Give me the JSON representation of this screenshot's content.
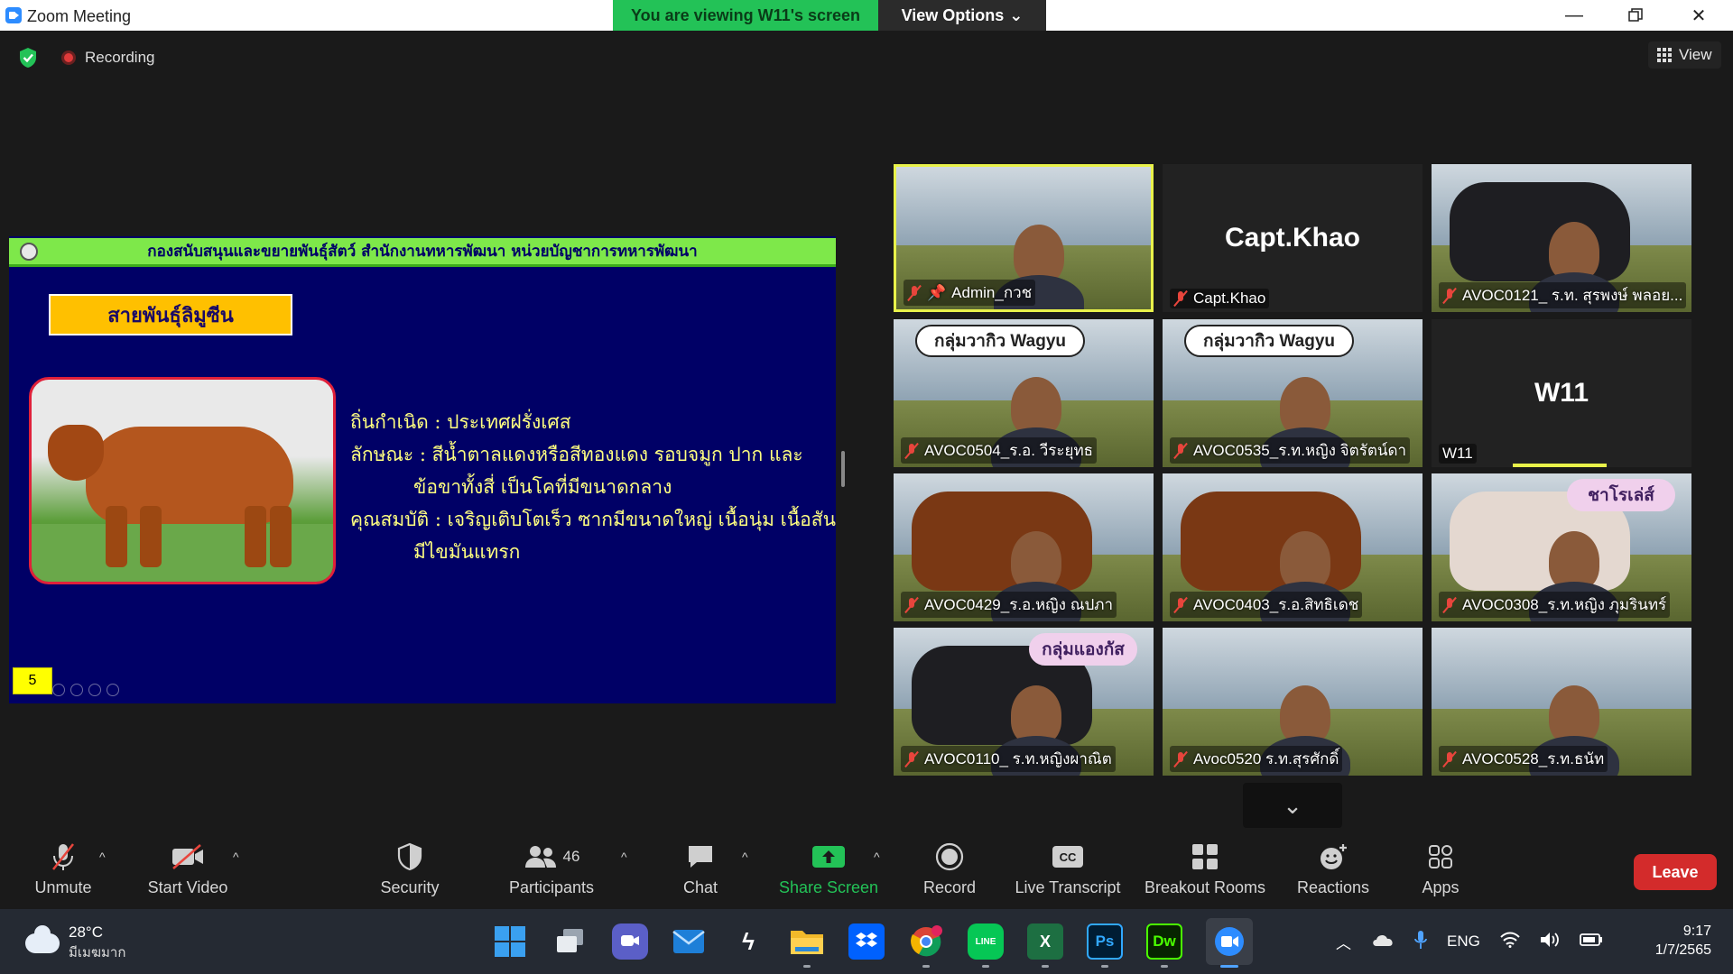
{
  "window": {
    "title": "Zoom Meeting",
    "banner": "You are viewing W11's screen",
    "view_options": "View Options"
  },
  "meeting_bar": {
    "recording": "Recording",
    "view": "View"
  },
  "slide": {
    "header": "กองสนับสนุนและขยายพันธุ์สัตว์ สำนักงานทหารพัฒนา หน่วยบัญชาการทหารพัฒนา",
    "breed_title": "สายพันธุ์ลิมูซีน",
    "lines": [
      "ถิ่นกำเนิด : ประเทศฝรั่งเศส",
      "ลักษณะ  : สีน้ำตาลแดงหรือสีทองแดง รอบจมูก ปาก และ",
      "ข้อขาทั้งสี่ เป็นโคที่มีขนาดกลาง",
      "คุณสมบัติ : เจริญเติบโตเร็ว ซากมีขนาดใหญ่ เนื้อนุ่ม เนื้อสัน",
      "มีไขมันแทรก"
    ],
    "page_number": "5"
  },
  "gallery": [
    {
      "name": "Admin_กวช",
      "bg": "#d8d4c8",
      "pinned": true,
      "active": true
    },
    {
      "name": "Capt.Khao",
      "big": "Capt.Khao",
      "bg": "#222222"
    },
    {
      "name": "AVOC0121_ ร.ท. สุรพงษ์  พลอย...",
      "bg": "#3b4050"
    },
    {
      "name": "AVOC0504_ร.อ. วีระยุทธ",
      "bubble": "กลุ่มวากิว Wagyu",
      "bg": "#8a9a7a"
    },
    {
      "name": "AVOC0535_ร.ท.หญิง จิตรัตน์ดา",
      "bubble": "กลุ่มวากิว Wagyu",
      "bg": "#8a9a7a"
    },
    {
      "name": "W11",
      "big": "W11",
      "bg": "#222222"
    },
    {
      "name": "AVOC0429_ร.อ.หญิง ณปภา",
      "bg": "#7a7a5a"
    },
    {
      "name": "AVOC0403_ร.อ.สิทธิเดช",
      "bg": "#7a7a5a"
    },
    {
      "name": "AVOC0308_ร.ท.หญิง ภุมรินทร์",
      "label": "ชาโรเล่ส์",
      "bg": "#c4a8c8"
    },
    {
      "name": "AVOC0110_ ร.ท.หญิงผาณิต",
      "label": "กลุ่มแองกัส",
      "bg": "#7ab04a"
    },
    {
      "name": "Avoc0520 ร.ท.สุรศักดิ์",
      "bg": "#d8d8d8"
    },
    {
      "name": "AVOC0528_ร.ท.ธนัท",
      "bg": "#6a5a40"
    }
  ],
  "toolbar": {
    "unmute": "Unmute",
    "start_video": "Start Video",
    "security": "Security",
    "participants": "Participants",
    "participants_count": "46",
    "chat": "Chat",
    "share_screen": "Share Screen",
    "record": "Record",
    "live_transcript": "Live Transcript",
    "breakout_rooms": "Breakout Rooms",
    "reactions": "Reactions",
    "apps": "Apps",
    "leave": "Leave"
  },
  "taskbar": {
    "temperature": "28°C",
    "weather": "มีเมฆมาก",
    "language": "ENG",
    "time": "9:17",
    "date": "1/7/2565"
  },
  "colors": {
    "banner_green": "#23c257",
    "leave_red": "#d32b2b",
    "slide_blue": "#000066",
    "muted_mic": "#e8453c",
    "active_speaker": "#e9f24a"
  }
}
